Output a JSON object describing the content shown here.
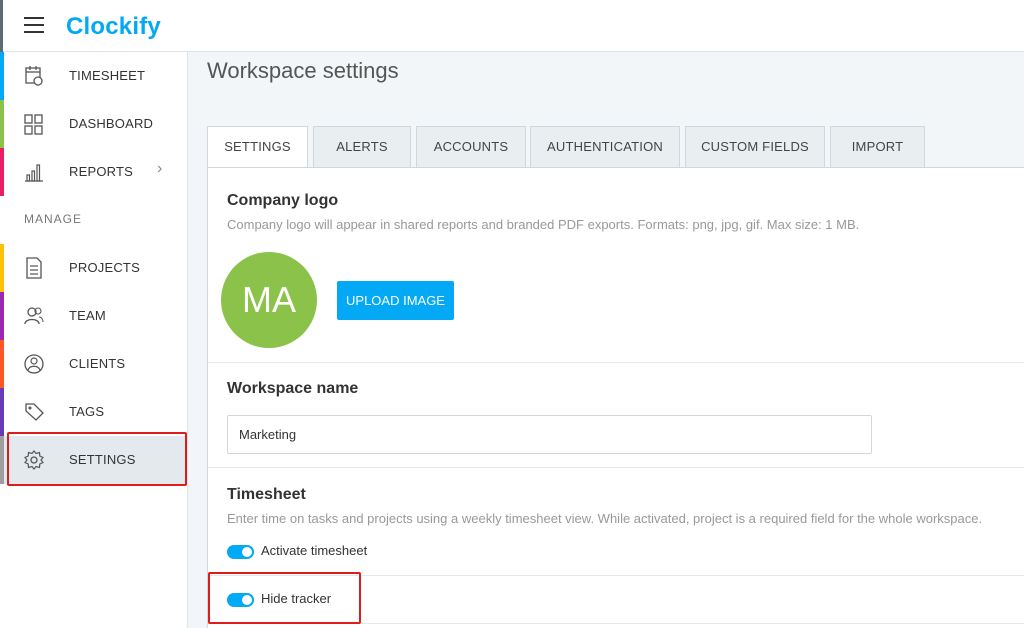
{
  "app": {
    "logo_text": "Clockify",
    "brand_color": "#03a9f4"
  },
  "sidebar": {
    "section_manage": "MANAGE",
    "items": [
      {
        "label": "TIMESHEET",
        "icon": "timesheet-icon",
        "bar_color": "#03a9f4"
      },
      {
        "label": "DASHBOARD",
        "icon": "dashboard-icon",
        "bar_color": "#8bc34a"
      },
      {
        "label": "REPORTS",
        "icon": "reports-icon",
        "bar_color": "#e91e63",
        "has_submenu": true
      },
      {
        "label": "PROJECTS",
        "icon": "projects-icon",
        "bar_color": "#ffc107"
      },
      {
        "label": "TEAM",
        "icon": "team-icon",
        "bar_color": "#9c27b0"
      },
      {
        "label": "CLIENTS",
        "icon": "clients-icon",
        "bar_color": "#ff5722"
      },
      {
        "label": "TAGS",
        "icon": "tags-icon",
        "bar_color": "#673ab7"
      },
      {
        "label": "SETTINGS",
        "icon": "gear-icon",
        "bar_color": "#9e9e9e",
        "active": true
      }
    ]
  },
  "page": {
    "title": "Workspace settings",
    "tabs": [
      {
        "label": "SETTINGS",
        "active": true
      },
      {
        "label": "ALERTS"
      },
      {
        "label": "ACCOUNTS"
      },
      {
        "label": "AUTHENTICATION"
      },
      {
        "label": "CUSTOM FIELDS"
      },
      {
        "label": "IMPORT"
      }
    ]
  },
  "company_logo": {
    "title": "Company logo",
    "description": "Company logo will appear in shared reports and branded PDF exports. Formats: png, jpg, gif. Max size: 1 MB.",
    "avatar_initials": "MA",
    "avatar_color": "#8bc34a",
    "upload_button": "UPLOAD IMAGE"
  },
  "workspace_name": {
    "title": "Workspace name",
    "value": "Marketing"
  },
  "timesheet": {
    "title": "Timesheet",
    "description": "Enter time on tasks and projects using a weekly timesheet view. While activated, project is a required field for the whole workspace.",
    "activate_label": "Activate timesheet",
    "activate_on": true,
    "hide_tracker_label": "Hide tracker",
    "hide_tracker_on": true
  }
}
